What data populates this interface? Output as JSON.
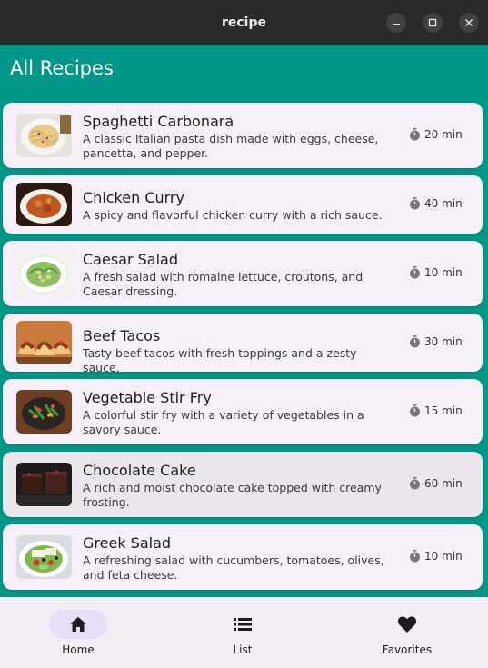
{
  "window": {
    "title": "recipe"
  },
  "header": {
    "title": "All Recipes"
  },
  "recipes": [
    {
      "title": "Spaghetti Carbonara",
      "description": "A classic Italian pasta dish made with eggs, cheese, pancetta, and pepper.",
      "time": "20 min",
      "image": "pasta-plate"
    },
    {
      "title": "Chicken Curry",
      "description": "A spicy and flavorful chicken curry with a rich sauce.",
      "time": "40 min",
      "image": "curry-bowl"
    },
    {
      "title": "Caesar Salad",
      "description": "A fresh salad with romaine lettuce, croutons, and Caesar dressing.",
      "time": "10 min",
      "image": "salad-plate"
    },
    {
      "title": "Beef Tacos",
      "description": "Tasty beef tacos with fresh toppings and a zesty sauce.",
      "time": "30 min",
      "image": "tacos"
    },
    {
      "title": "Vegetable Stir Fry",
      "description": "A colorful stir fry with a variety of vegetables in a savory sauce.",
      "time": "15 min",
      "image": "stir-fry"
    },
    {
      "title": "Chocolate Cake",
      "description": "A rich and moist chocolate cake topped with creamy frosting.",
      "time": "60 min",
      "image": "chocolate-cake"
    },
    {
      "title": "Greek Salad",
      "description": "A refreshing salad with cucumbers, tomatoes, olives, and feta cheese.",
      "time": "10 min",
      "image": "greek-salad"
    }
  ],
  "nav": {
    "home": "Home",
    "list": "List",
    "favorites": "Favorites",
    "active": "home"
  },
  "colors": {
    "background": "#009688",
    "card": "#f8f0f8",
    "card_selected": "#ebe5ec",
    "nav_bar": "#f3edf6",
    "nav_active_pill": "#e8def8"
  }
}
